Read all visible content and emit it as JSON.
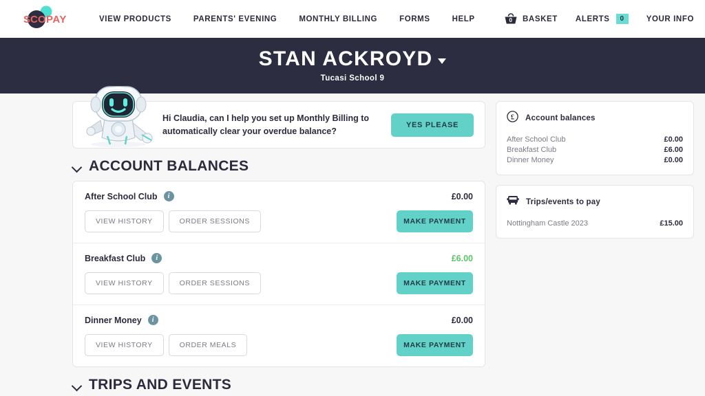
{
  "nav": {
    "logo_text": "SCOPAY",
    "links": [
      {
        "label": "VIEW PRODUCTS"
      },
      {
        "label": "PARENTS' EVENING"
      },
      {
        "label": "MONTHLY BILLING"
      },
      {
        "label": "FORMS"
      },
      {
        "label": "HELP"
      }
    ],
    "basket": {
      "label": "BASKET",
      "count": "0",
      "icon": "basket-icon"
    },
    "alerts": {
      "label": "ALERTS",
      "count": "0"
    },
    "your_info": {
      "label": "YOUR INFO"
    }
  },
  "hero": {
    "title": "STAN ACKROYD",
    "subtitle": "Tucasi School 9"
  },
  "banner": {
    "message": "Hi Claudia, can I help you set up Monthly Billing to automatically clear your overdue balance?",
    "button_label": "YES PLEASE",
    "robot_icon": "robot-assistant-icon"
  },
  "sections": {
    "account_balances_title": "ACCOUNT BALANCES",
    "trips_and_events_title": "TRIPS AND EVENTS"
  },
  "accounts": [
    {
      "name": "After School Club",
      "amount": "£0.00",
      "amount_color": "#2b2b3d",
      "history_label": "VIEW HISTORY",
      "order_label": "ORDER SESSIONS",
      "pay_label": "MAKE PAYMENT"
    },
    {
      "name": "Breakfast Club",
      "amount": "£6.00",
      "amount_color": "#5cc46a",
      "history_label": "VIEW HISTORY",
      "order_label": "ORDER SESSIONS",
      "pay_label": "MAKE PAYMENT"
    },
    {
      "name": "Dinner Money",
      "amount": "£0.00",
      "amount_color": "#2b2b3d",
      "history_label": "VIEW HISTORY",
      "order_label": "ORDER MEALS",
      "pay_label": "MAKE PAYMENT"
    }
  ],
  "sidebar": {
    "balances_panel": {
      "icon": "pound-circle-icon",
      "title": "Account balances",
      "rows": [
        {
          "label": "After School Club",
          "value": "£0.00",
          "color": "#2b2b3d"
        },
        {
          "label": "Breakfast Club",
          "value": "£6.00",
          "color": "#5cc46a"
        },
        {
          "label": "Dinner Money",
          "value": "£0.00",
          "color": "#2b2b3d"
        }
      ]
    },
    "trips_panel": {
      "icon": "bus-icon",
      "title": "Trips/events to pay",
      "rows": [
        {
          "label": "Nottingham Castle 2023",
          "value": "£15.00",
          "color": "#e0353b"
        }
      ]
    }
  },
  "colors": {
    "accent_teal": "#62d2c8",
    "header_dark": "#2d2d42",
    "page_bg": "#f7f7f8",
    "positive_green": "#5cc46a",
    "due_red": "#e0353b"
  }
}
